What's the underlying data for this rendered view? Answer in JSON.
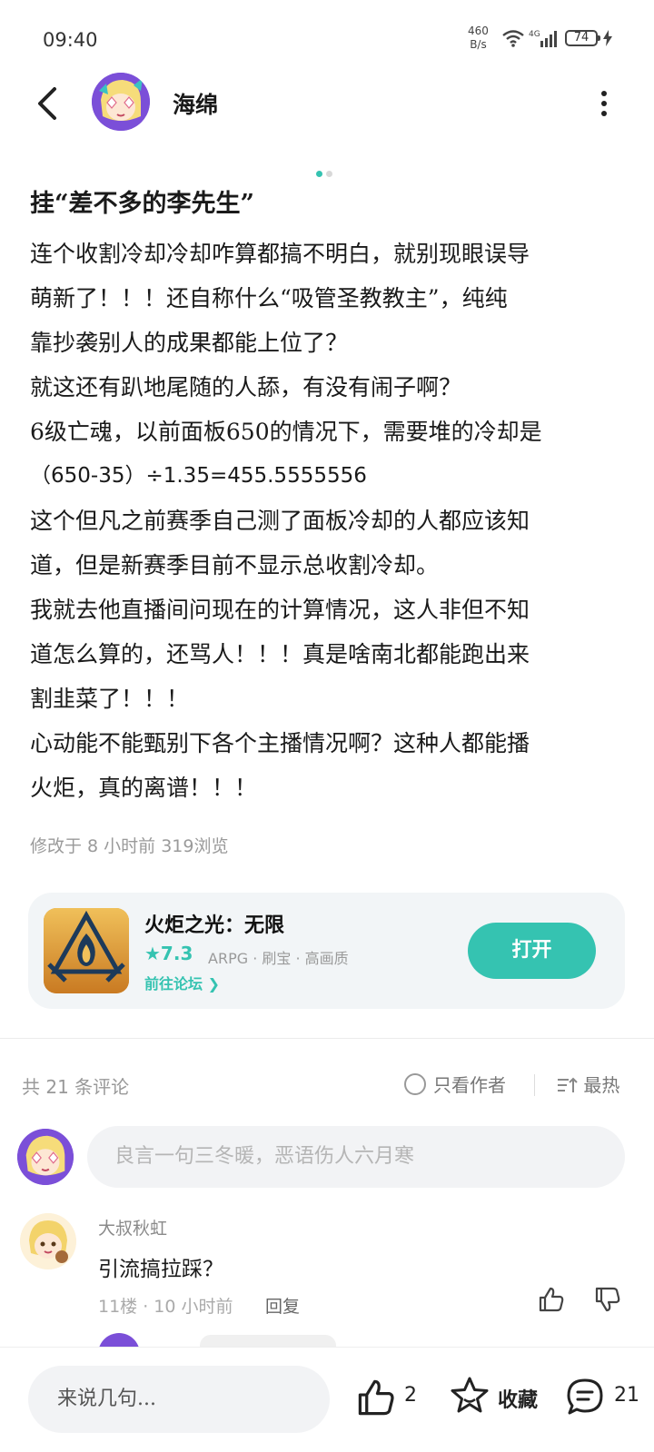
{
  "status": {
    "time": "09:40",
    "net_speed": "460",
    "net_unit": "B/s",
    "network": "4G",
    "battery": "74"
  },
  "header": {
    "author": "海绵"
  },
  "post": {
    "title": "挂“差不多的李先生”",
    "lines": [
      "连个收割冷却冷却咋算都搞不明白，就别现眼误导",
      "萌新了！！！还自称什么“吸管圣教教主”，纯纯",
      "靠抄袭别人的成果都能上位了？",
      "就这还有趴地尾随的人舔，有没有闹子啊？",
      "6级亡魂，以前面板650的情况下，需要堆的冷却是",
      "（650-35）÷1.35=455.5555556",
      "这个但凡之前赛季自己测了面板冷却的人都应该知",
      "道，但是新赛季目前不显示总收割冷却。",
      "我就去他直播间问现在的计算情况，这人非但不知",
      "道怎么算的，还骂人！！！真是啥南北都能跑出来",
      "割韭菜了！！！",
      "心动能不能甄别下各个主播情况啊？这种人都能播",
      "火炬，真的离谱！！！"
    ],
    "meta": "修改于 8 小时前  319浏览"
  },
  "game": {
    "name": "火炬之光：无限",
    "rating": "★7.3",
    "tags": "ARPG · 刷宝 · 高画质",
    "forum_link": "前往论坛 ❯",
    "open_label": "打开"
  },
  "comments": {
    "count_label": "共 21 条评论",
    "only_author": "只看作者",
    "sort_label": "最热",
    "input_placeholder": "良言一句三冬暖，恶语伤人六月寒",
    "items": [
      {
        "user": "大叔秋虹",
        "text": "引流搞拉踩？",
        "meta": "11楼 · 10 小时前",
        "reply": "回复"
      }
    ]
  },
  "bottom": {
    "input_placeholder": "来说几句...",
    "like_count": "2",
    "fav_label": "收藏",
    "comment_count": "21"
  },
  "colors": {
    "accent": "#35c3b1",
    "avatar_bg": "#7b4fd8"
  }
}
